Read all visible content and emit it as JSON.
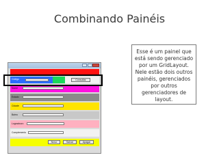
{
  "slide": {
    "title": "Combinando Painéis",
    "note": "Esse é um painel que está sendo gerenciado por um GridLayout. Nele estão dois outros painéis, gerenciados por outros gerenciadores de layout."
  },
  "form": {
    "code_label": "Código",
    "consult_button": "Consultar",
    "name_label": "Nome",
    "state_label": "Estado",
    "city_label": "Cidade",
    "neighborhood_label": "Bairro",
    "street_label": "Logradouro",
    "complement_label": "Complemento",
    "new_button": "Novo",
    "save_button": "Salvar",
    "delete_button": "Apagar"
  },
  "colors": {
    "red": "#ff1010",
    "code_panel": "#2b6cff",
    "green": "#19d85a",
    "magenta": "#ff10e0",
    "gray": "#8a8a8a",
    "yellow": "#ffe400",
    "silver": "#c8c8c8",
    "pink": "#ffb0c0",
    "buttons_panel": "#f6ff00"
  }
}
